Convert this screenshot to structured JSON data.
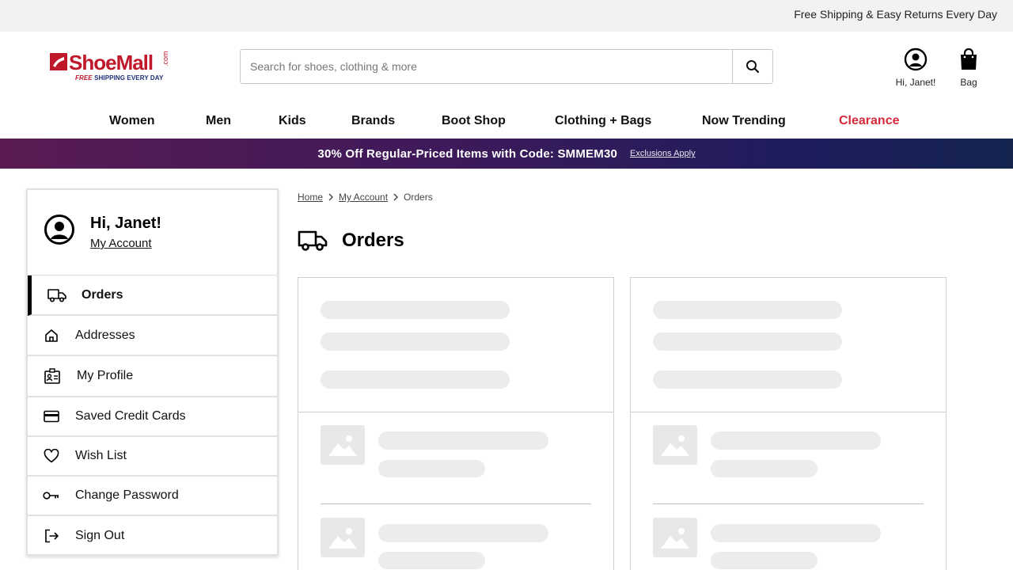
{
  "announcement": "Free Shipping & Easy Returns Every Day",
  "logo": {
    "name": "ShoeMall",
    "suffix": ".com",
    "tagline_highlight": "FREE",
    "tagline_rest": "SHIPPING EVERY DAY",
    "colors": {
      "red": "#c0182b",
      "blue": "#1c2e7a"
    }
  },
  "search": {
    "placeholder": "Search for shoes, clothing & more",
    "value": "",
    "icon": "search-icon"
  },
  "header": {
    "account_label": "Hi, Janet!",
    "bag_label": "Bag"
  },
  "nav": {
    "items": [
      "Women",
      "Men",
      "Kids",
      "Brands",
      "Boot Shop",
      "Clothing + Bags",
      "Now Trending",
      "Clearance"
    ],
    "highlight_color": "#d6293a"
  },
  "promo": {
    "text": "30% Off Regular-Priced Items with Code: SMMEM30",
    "link": "Exclusions Apply"
  },
  "sidebar": {
    "greeting": "Hi, Janet!",
    "account_link": "My Account",
    "items": [
      {
        "label": "Orders",
        "icon": "truck-icon",
        "active": true
      },
      {
        "label": "Addresses",
        "icon": "home-icon"
      },
      {
        "label": "My Profile",
        "icon": "id-card-icon"
      },
      {
        "label": "Saved Credit Cards",
        "icon": "credit-card-icon"
      },
      {
        "label": "Wish List",
        "icon": "heart-icon"
      },
      {
        "label": "Change Password",
        "icon": "key-icon"
      },
      {
        "label": "Sign Out",
        "icon": "sign-out-icon"
      }
    ]
  },
  "breadcrumb": [
    "Home",
    "My Account",
    "Orders"
  ],
  "page_title": "Orders",
  "orders_loading": true
}
